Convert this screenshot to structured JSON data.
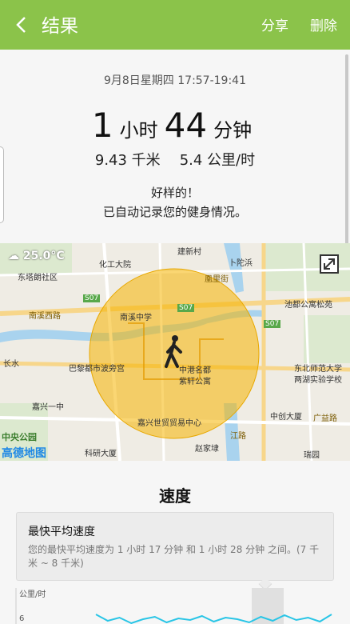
{
  "header": {
    "title": "结果",
    "share_label": "分享",
    "delete_label": "删除",
    "bg_color": "#8bc34a"
  },
  "summary": {
    "date_range": "9月8日星期四 17:57-19:41",
    "hours": "1",
    "hours_unit": "小时",
    "minutes": "44",
    "minutes_unit": "分钟",
    "distance": "9.43 千米",
    "speed": "5.4 公里/时",
    "message_line1": "好样的！",
    "message_line2": "已自动记录您的健身情况。"
  },
  "map": {
    "temperature": "25.0°C",
    "logo": "高德地图",
    "park": "中央公园",
    "labels": [
      "建新村",
      "化工大院",
      "卜陀浜",
      "东塔朗社区",
      "凰里街",
      "南溪西路",
      "南溪中学",
      "S07",
      "S07",
      "S07",
      "长水",
      "巴黎都市波旁宫",
      "中港名都",
      "紫轩公寓",
      "嘉兴一中",
      "嘉兴世贸贸易中心",
      "东北师范大学",
      "两湖实验学校",
      "池都公寓松苑",
      "中创大厦",
      "广益路",
      "赵家埭",
      "瑞园",
      "科研大厦",
      "江路"
    ],
    "walk_icon": "walking-person-icon",
    "expand_icon": "expand-icon"
  },
  "speed_section": {
    "title": "速度",
    "card_title": "最快平均速度",
    "card_text": "您的最快平均速度为 1 小时 17 分钟 和 1 小时 28 分钟 之间。(7 千米 ~ 8 千米)"
  },
  "chart_data": {
    "type": "line",
    "ylabel": "公里/时",
    "yticks": [
      "6"
    ],
    "series": [
      {
        "values": [
          6.2,
          5.4,
          5.8,
          5.1,
          5.6,
          5.9,
          5.2,
          5.7,
          5.5,
          6.0,
          5.3,
          5.8,
          5.6,
          5.2,
          5.9,
          5.4,
          6.1,
          5.5,
          5.8,
          5.3,
          6.2
        ]
      }
    ],
    "color": "#29c5e6"
  }
}
